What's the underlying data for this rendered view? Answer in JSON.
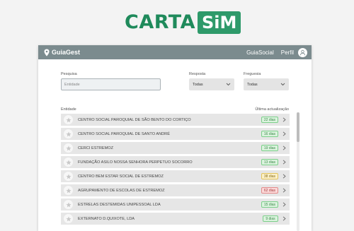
{
  "brand": {
    "part1": "CARTA",
    "part2": "SiM"
  },
  "app": {
    "name": "GuiaGest",
    "nav": [
      {
        "label": "GuiaSocial"
      },
      {
        "label": "Perfil"
      }
    ]
  },
  "filters": {
    "search": {
      "label": "Pesquisa",
      "placeholder": "Entidade"
    },
    "resposta": {
      "label": "Resposta",
      "value": "Todas"
    },
    "freguesia": {
      "label": "Freguesia",
      "value": "Todas"
    }
  },
  "list": {
    "col_entity": "Entidade",
    "col_update": "Última actualização",
    "rows": [
      {
        "name": "Centro Social Paroquial de São Bento do Cortiço",
        "days": "22 dias",
        "status": "green"
      },
      {
        "name": "Centro Social Paroquial de Santo André",
        "days": "16 dias",
        "status": "green"
      },
      {
        "name": "CERCI Estremoz",
        "days": "19 dias",
        "status": "green"
      },
      {
        "name": "Fundação Asilo Nossa Senhora Perpetuo Socorro",
        "days": "13 dias",
        "status": "green"
      },
      {
        "name": "Centro Bem Estar Social de Estremoz",
        "days": "38 dias",
        "status": "yellow"
      },
      {
        "name": "Agrupamento de Escolas de Estremoz",
        "days": "62 dias",
        "status": "red"
      },
      {
        "name": "Estrelas Destemidas Unipessoal LDA",
        "days": "15 dias",
        "status": "green"
      },
      {
        "name": "Externato D.Quixote, LDA",
        "days": "9 dias",
        "status": "green"
      }
    ]
  },
  "colors": {
    "brand_green": "#1f8a5b",
    "topbar": "#7b8b8e",
    "badge_green": "#7ccf8a",
    "badge_yellow": "#e3c35a",
    "badge_red": "#e38b8b"
  }
}
